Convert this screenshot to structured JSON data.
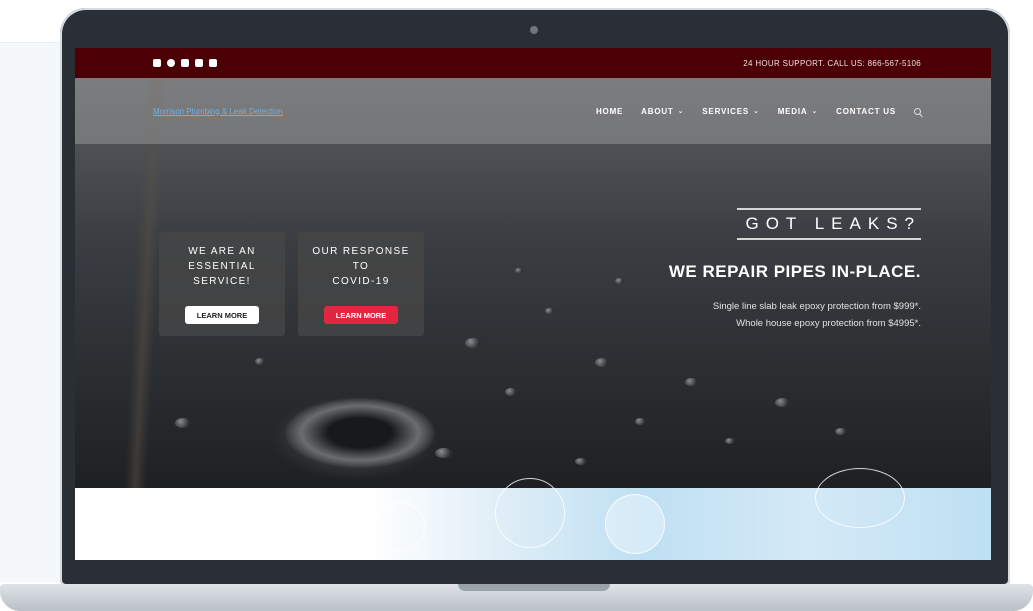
{
  "topbar": {
    "social_icons": [
      "twitter-icon",
      "facebook-icon",
      "instagram-icon",
      "linkedin-icon",
      "youtube-icon"
    ],
    "support_text": "24 HOUR SUPPORT. CALL US: 866-567-5106"
  },
  "nav": {
    "logo_alt": "Morrison Plumbing & Leak Detection",
    "items": [
      {
        "label": "HOME",
        "dropdown": false
      },
      {
        "label": "ABOUT",
        "dropdown": true
      },
      {
        "label": "SERVICES",
        "dropdown": true
      },
      {
        "label": "MEDIA",
        "dropdown": true
      },
      {
        "label": "CONTACT US",
        "dropdown": false
      }
    ]
  },
  "cards": [
    {
      "title": "WE ARE AN\nESSENTIAL\nSERVICE!",
      "button": "LEARN MORE"
    },
    {
      "title": "OUR RESPONSE\nTO\nCOVID-19",
      "button": "LEARN MORE"
    }
  ],
  "hero": {
    "tagline": "GOT LEAKS?",
    "headline": "WE REPAIR PIPES IN-PLACE.",
    "offer_line_1": "Single line slab leak epoxy protection from $999*.",
    "offer_line_2": "Whole house epoxy protection from $4995*."
  },
  "colors": {
    "topbar": "#4a0005",
    "accent_red": "#e3263f",
    "laptop_frame": "#2a2f35"
  }
}
